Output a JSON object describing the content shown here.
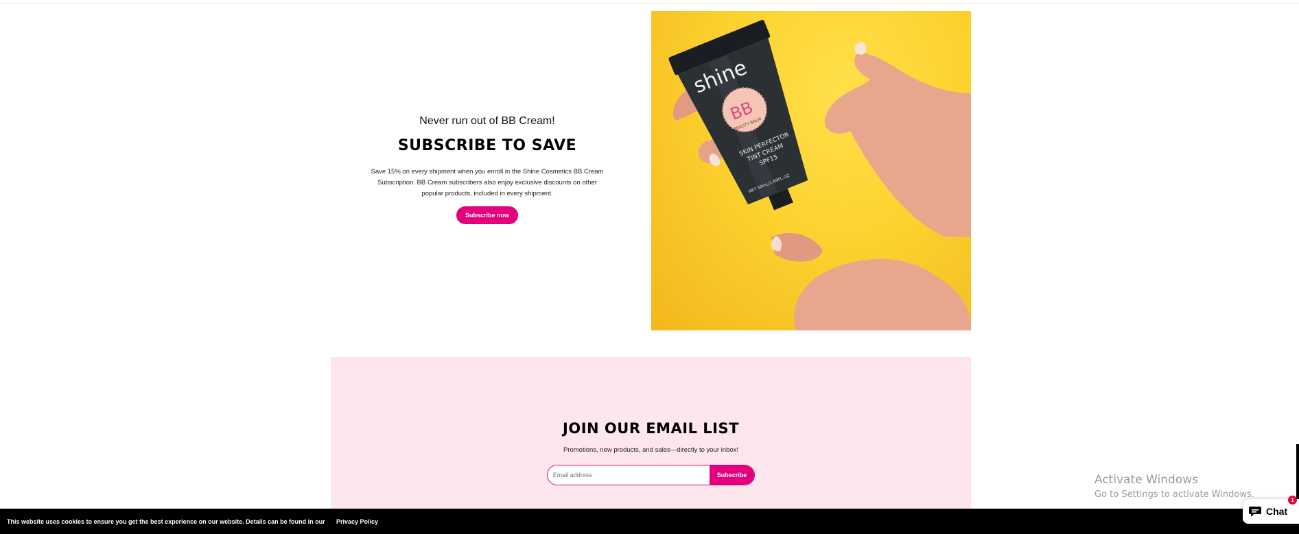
{
  "subscribe": {
    "eyebrow": "Never run out of BB Cream!",
    "headline": "SUBSCRIBE TO SAVE",
    "body": "Save 15% on every shipment when you enroll in the Shine Cosmetics BB Cream Subscription. BB Cream subscribers also enjoy exclusive discounts on other popular products, included in every shipment.",
    "button_label": "Subscribe now"
  },
  "hero": {
    "brand": "shine",
    "bb": "BB",
    "beauty_balm": "BEAUTY BALM",
    "product_line1": "SKIN PERFECTOR",
    "product_line2": "TINT CREAM",
    "product_line3": "SPF15",
    "net": "NET 50mL/1.69FL.OZ",
    "accent_color": "#fcd22f"
  },
  "email_list": {
    "title": "JOIN OUR EMAIL LIST",
    "subtitle": "Promotions, new products, and sales—directly to your inbox!",
    "input_placeholder": "Email address",
    "submit_label": "Subscribe"
  },
  "watermark": {
    "line1": "Activate Windows",
    "line2": "Go to Settings to activate Windows."
  },
  "cookie": {
    "text": "This website uses cookies to ensure you get the best experience on our website. Details can be found in our",
    "link_label": "Privacy Policy"
  },
  "chat": {
    "label": "Chat",
    "badge": "1",
    "icon": "chat-bubble-icon"
  },
  "colors": {
    "brand_pink": "#e4007c",
    "band_pink": "#fde6ec",
    "cookie_bg": "#000000"
  }
}
